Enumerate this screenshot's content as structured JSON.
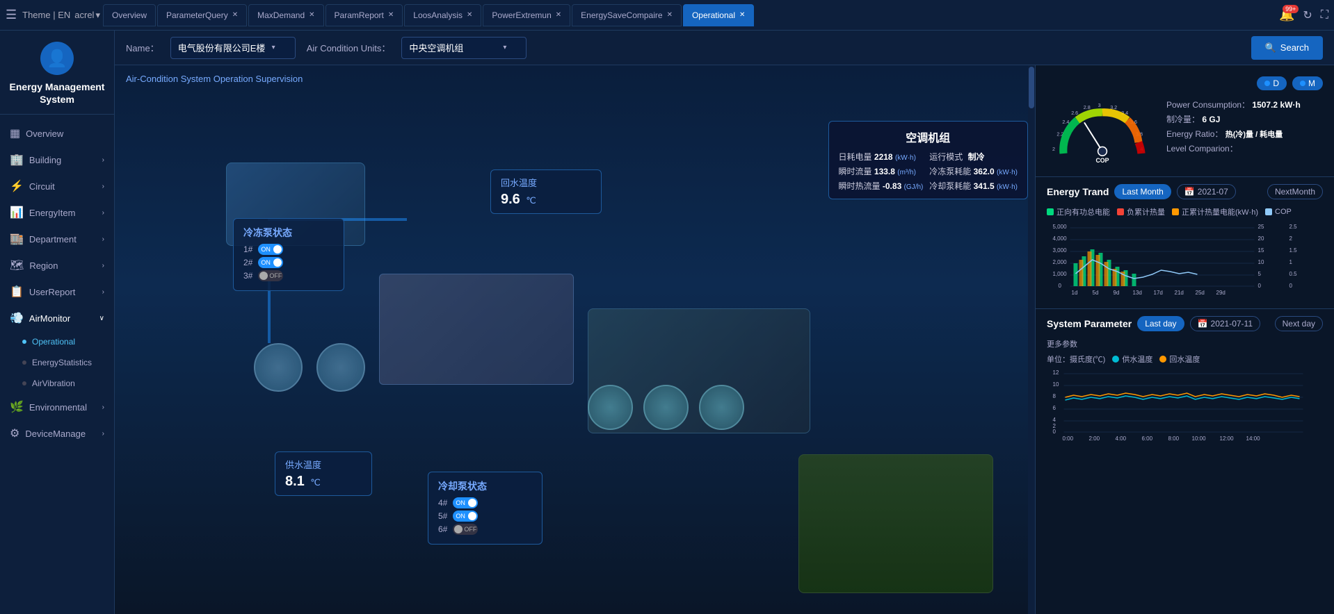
{
  "topbar": {
    "theme_label": "Theme | EN",
    "acrel_label": "acrel",
    "notification_count": "99+",
    "tabs": [
      {
        "label": "Overview",
        "id": "overview",
        "active": false,
        "closable": false
      },
      {
        "label": "ParameterQuery",
        "id": "paramquery",
        "active": false,
        "closable": true
      },
      {
        "label": "MaxDemand",
        "id": "maxdemand",
        "active": false,
        "closable": true
      },
      {
        "label": "ParamReport",
        "id": "paramreport",
        "active": false,
        "closable": true
      },
      {
        "label": "LoosAnalysis",
        "id": "loosanalysis",
        "active": false,
        "closable": true
      },
      {
        "label": "PowerExtremun",
        "id": "powerextremun",
        "active": false,
        "closable": true
      },
      {
        "label": "EnergySaveCompaire",
        "id": "energysave",
        "active": false,
        "closable": true
      },
      {
        "label": "Operational",
        "id": "operational",
        "active": true,
        "closable": true
      }
    ]
  },
  "sidebar": {
    "brand_title": "Energy Management System",
    "items": [
      {
        "label": "Overview",
        "icon": "▦",
        "hasChildren": false,
        "id": "overview"
      },
      {
        "label": "Building",
        "icon": "🏢",
        "hasChildren": true,
        "id": "building"
      },
      {
        "label": "Circuit",
        "icon": "⚡",
        "hasChildren": true,
        "id": "circuit"
      },
      {
        "label": "EnergyItem",
        "icon": "📊",
        "hasChildren": true,
        "id": "energyitem"
      },
      {
        "label": "Department",
        "icon": "🏬",
        "hasChildren": true,
        "id": "department"
      },
      {
        "label": "Region",
        "icon": "🗺",
        "hasChildren": true,
        "id": "region"
      },
      {
        "label": "UserReport",
        "icon": "📋",
        "hasChildren": true,
        "id": "userreport"
      },
      {
        "label": "AirMonitor",
        "icon": "💨",
        "hasChildren": true,
        "id": "airmonitor",
        "expanded": true
      },
      {
        "label": "Environmental",
        "icon": "🌿",
        "hasChildren": true,
        "id": "environmental"
      },
      {
        "label": "DeviceManage",
        "icon": "⚙",
        "hasChildren": true,
        "id": "devicemanage"
      }
    ],
    "airmonitor_children": [
      {
        "label": "Operational",
        "active": true
      },
      {
        "label": "EnergyStatistics",
        "active": false
      },
      {
        "label": "AirVibration",
        "active": false
      }
    ]
  },
  "filter": {
    "name_label": "Name：",
    "name_value": "电气股份有限公司E楼",
    "air_condition_label": "Air Condition Units：",
    "air_condition_value": "中央空调机组",
    "search_btn": "Search"
  },
  "left_panel": {
    "title": "Air-Condition System Operation Supervision",
    "freeze_pump": {
      "title": "冷冻泵状态",
      "pumps": [
        {
          "id": "1#",
          "status": "ON"
        },
        {
          "id": "2#",
          "status": "ON"
        },
        {
          "id": "3#",
          "status": "OFF"
        }
      ]
    },
    "supply_temp": {
      "title": "供水温度",
      "value": "8.1",
      "unit": "℃"
    },
    "return_temp": {
      "title": "回水温度",
      "value": "9.6",
      "unit": "℃"
    },
    "cool_pump": {
      "title": "冷却泵状态",
      "pumps": [
        {
          "id": "4#",
          "status": "ON"
        },
        {
          "id": "5#",
          "status": "ON"
        },
        {
          "id": "6#",
          "status": "OFF"
        }
      ]
    },
    "ac_unit": {
      "title": "空调机组",
      "daily_energy_label": "日耗电量",
      "daily_energy_value": "2218",
      "daily_energy_unit": "(kW·h)",
      "run_mode_label": "运行模式",
      "run_mode_value": "制冷",
      "instant_flow_label": "瞬时流量",
      "instant_flow_value": "133.8",
      "instant_flow_unit": "(m³/h)",
      "freeze_energy_label": "冷冻泵耗能",
      "freeze_energy_value": "362.0",
      "freeze_energy_unit": "(kW·h)",
      "instant_heat_label": "瞬时热流量",
      "instant_heat_value": "-0.83",
      "instant_heat_unit": "(GJ/h)",
      "cool_energy_label": "冷却泵耗能",
      "cool_energy_value": "341.5",
      "cool_energy_unit": "(kW·h)"
    }
  },
  "right_panel": {
    "gauge": {
      "cop_label": "COP",
      "toggle_d": "D",
      "toggle_m": "M",
      "power_consumption_label": "Power Consumption：",
      "power_consumption_value": "1507.2 kW·h",
      "cooling_label": "制冷量：",
      "cooling_value": "6 GJ",
      "energy_ratio_label": "Energy Ratio：",
      "energy_ratio_value": "热(冷)量 / 耗电量",
      "level_comparison_label": "Level Comparion："
    },
    "energy_trand": {
      "title": "Energy Trand",
      "last_month_btn": "Last Month",
      "date_value": "2021-07",
      "next_month_btn": "NextMonth",
      "legend": [
        {
          "label": "正向有功总电能",
          "color": "#00d97e"
        },
        {
          "label": "负累计热量",
          "color": "#f44336"
        },
        {
          "label": "正累计热量电能(kW·h)",
          "color": "#ff9800"
        },
        {
          "label": "COP",
          "color": "#90caf9"
        }
      ],
      "y_labels_left": [
        "5,000",
        "4,000",
        "3,000",
        "2,000",
        "1,000",
        "0"
      ],
      "y_labels_right": [
        "25",
        "20",
        "15",
        "10",
        "5",
        "0"
      ],
      "y_labels_far_right": [
        "2.5",
        "2",
        "1.5",
        "1",
        "0.5",
        "0"
      ],
      "x_labels": [
        "1d",
        "5d",
        "9d",
        "13d",
        "17d",
        "21d",
        "25d",
        "29d"
      ]
    },
    "system_parameter": {
      "title": "System Parameter",
      "last_day_btn": "Last day",
      "date_value": "2021-07-11",
      "next_day_btn": "Next day",
      "subtitle": "更多参数",
      "unit_label": "单位：摄氏度(℃)",
      "legend": [
        {
          "label": "供水温度",
          "color": "#00bcd4"
        },
        {
          "label": "回水温度",
          "color": "#ff9800"
        }
      ],
      "x_labels": [
        "0:00",
        "2:00",
        "4:00",
        "6:00",
        "8:00",
        "10:00",
        "12:00",
        "14:00"
      ]
    }
  }
}
